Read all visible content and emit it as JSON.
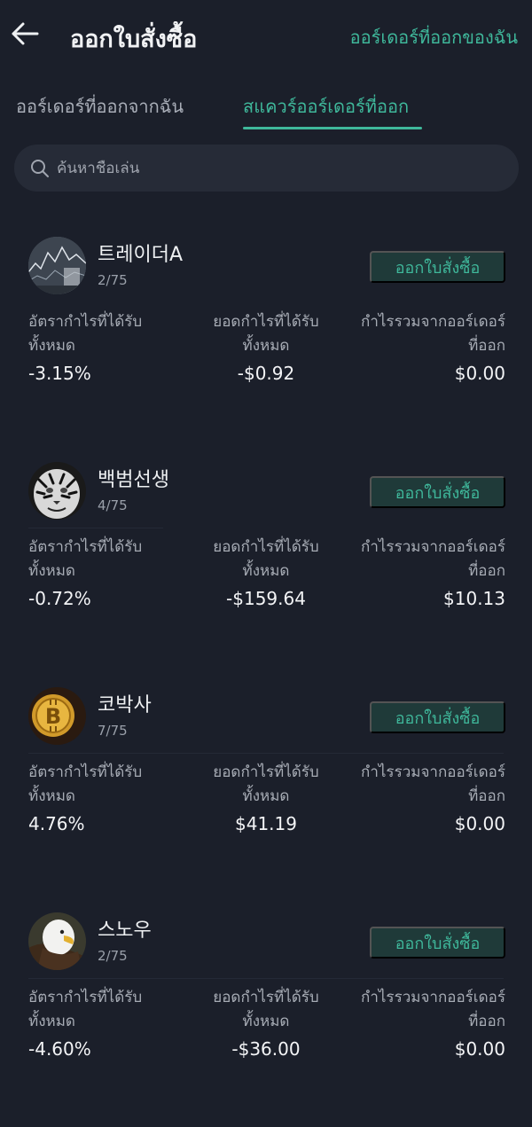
{
  "header": {
    "title": "ออกใบสั่งซื้อ",
    "link": "ออร์เดอร์ที่ออกของฉัน"
  },
  "tabs": [
    {
      "label": "ออร์เดอร์ที่ออกจากฉัน",
      "active": false
    },
    {
      "label": "สแควร์ออร์เดอร์ที่ออก",
      "active": true
    }
  ],
  "search": {
    "placeholder": "ค้นหาชื่อเล่น"
  },
  "stat_labels": {
    "rate": "อัตรากำไรที่ได้รับทั้งหมด",
    "amount": "ยอดกำไรที่ได้รับทั้งหมด",
    "total": "กำไรรวมจากออร์เดอร์ที่ออก"
  },
  "traders": [
    {
      "name": "트레이더A",
      "count": "2/75",
      "button": "ออกใบสั่งซื้อ",
      "rate": "-3.15%",
      "amount": "-$0.92",
      "total": "$0.00",
      "avatar_icon": "chart-avatar"
    },
    {
      "name": "백범선생",
      "count": "4/75",
      "button": "ออกใบสั่งซื้อ",
      "rate": "-0.72%",
      "amount": "-$159.64",
      "total": "$10.13",
      "avatar_icon": "tiger-avatar"
    },
    {
      "name": "코박사",
      "count": "7/75",
      "button": "ออกใบสั่งซื้อ",
      "rate": "4.76%",
      "amount": "$41.19",
      "total": "$0.00",
      "avatar_icon": "bitcoin-avatar"
    },
    {
      "name": "스노우",
      "count": "2/75",
      "button": "ออกใบสั่งซื้อ",
      "rate": "-4.60%",
      "amount": "-$36.00",
      "total": "$0.00",
      "avatar_icon": "eagle-avatar"
    }
  ],
  "colors": {
    "accent": "#3fb89b",
    "background": "#1b1f2a",
    "button_bg": "#1f3a39"
  }
}
